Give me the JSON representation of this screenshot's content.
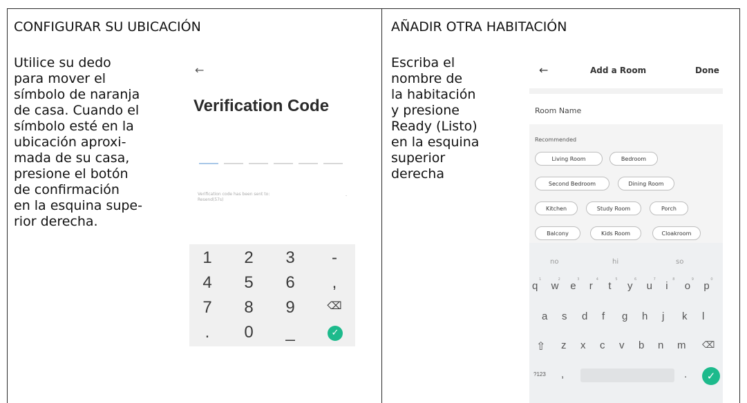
{
  "left_panel": {
    "heading": "CONFIGURAR SU UBICACIÓN",
    "lines": [
      "Utilice su dedo",
      "para mover el",
      "símbolo de naranja",
      "de casa. Cuando el",
      "símbolo esté en la",
      "ubicación aproxi-",
      "mada de su casa,",
      "presione el botón",
      "de confirmación",
      "en la esquina supe-",
      "rior derecha."
    ]
  },
  "right_panel": {
    "heading": "AÑADIR OTRA HABITACIÓN",
    "lines": [
      "Escriba el",
      "nombre de",
      "la habitación",
      "y presione",
      "Ready (Listo)",
      "en la esquina",
      "superior",
      "derecha"
    ]
  },
  "verification_phone": {
    "back_glyph": "←",
    "title": "Verification Code",
    "info_text": "Verification code has been sent to:\nResend(57s)",
    "info_dash": "-",
    "keys": [
      [
        "1",
        "2",
        "3",
        "-"
      ],
      [
        "4",
        "5",
        "6",
        ","
      ],
      [
        "7",
        "8",
        "9",
        "⌫"
      ],
      [
        ".",
        "0",
        "_",
        "✓"
      ]
    ]
  },
  "room_phone": {
    "back_glyph": "←",
    "title": "Add a Room",
    "done_label": "Done",
    "room_name_label": "Room Name",
    "recommended_label": "Recommended",
    "chips": [
      [
        "Living Room",
        "Bedroom"
      ],
      [
        "Second Bedroom",
        "Dining Room"
      ],
      [
        "Kitchen",
        "Study Room",
        "Porch"
      ],
      [
        "Balcony",
        "Kids Room",
        "Cloakroom"
      ]
    ],
    "suggestions": [
      "no",
      "hi",
      "so"
    ],
    "kb_row1": [
      "q",
      "w",
      "e",
      "r",
      "t",
      "y",
      "u",
      "i",
      "o",
      "p"
    ],
    "kb_row1_nums": [
      "1",
      "2",
      "3",
      "4",
      "5",
      "6",
      "7",
      "8",
      "9",
      "0"
    ],
    "kb_row2": [
      "a",
      "s",
      "d",
      "f",
      "g",
      "h",
      "j",
      "k",
      "l"
    ],
    "kb_row3": [
      "z",
      "x",
      "c",
      "v",
      "b",
      "n",
      "m"
    ],
    "kb_mode": "?123",
    "kb_comma": ",",
    "kb_period": ".",
    "accent": "#1dba8c"
  }
}
